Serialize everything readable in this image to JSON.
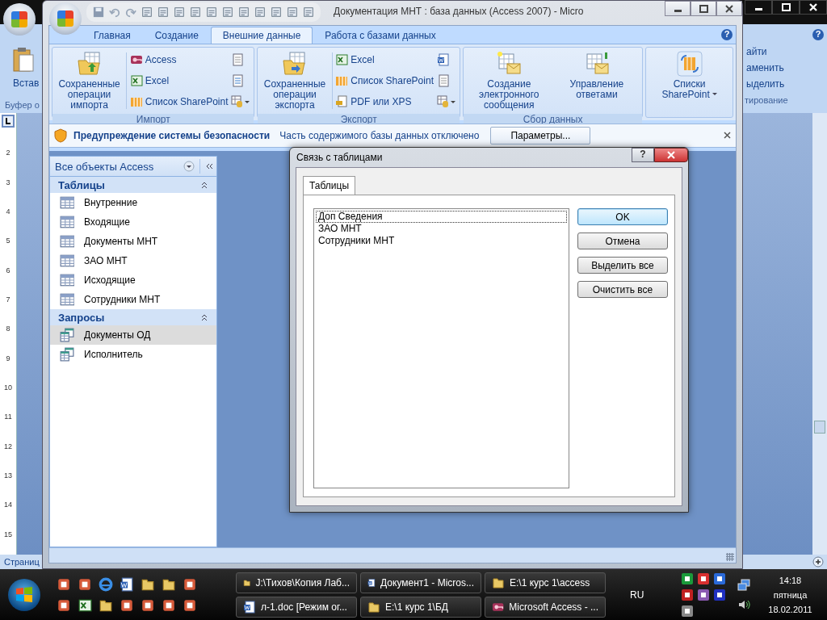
{
  "background_window": {
    "paste_button": "Встав",
    "clipboard_group": "Буфер о",
    "help_button": "?",
    "right_items": [
      "айти",
      "аменить",
      "ыделить"
    ],
    "right_group": "тирование",
    "ruler_marks": [
      "2",
      "3",
      "4",
      "5",
      "6",
      "7",
      "8",
      "9",
      "10",
      "11",
      "12",
      "13",
      "14",
      "15"
    ],
    "status": "Страниц"
  },
  "window": {
    "title": "Документация МНТ : база данных (Access 2007)  -  Micro"
  },
  "tabs": [
    {
      "label": "Главная",
      "selected": false
    },
    {
      "label": "Создание",
      "selected": false
    },
    {
      "label": "Внешние данные",
      "selected": true
    },
    {
      "label": "Работа с базами данных",
      "selected": false
    }
  ],
  "ribbon": {
    "help_button": "?",
    "groups": [
      {
        "label": "Импорт",
        "big": {
          "label": "Сохраненные операции импорта",
          "kind": "import"
        },
        "small": [
          {
            "label": "Access",
            "kind": "access"
          },
          {
            "label": "Excel",
            "kind": "excel"
          },
          {
            "label": "Список SharePoint",
            "kind": "sharepoint"
          }
        ],
        "icons": [
          {
            "kind": "text"
          },
          {
            "kind": "xml"
          },
          {
            "kind": "more"
          }
        ]
      },
      {
        "label": "Экспорт",
        "big": {
          "label": "Сохраненные операции экспорта",
          "kind": "export"
        },
        "small": [
          {
            "label": "Excel",
            "kind": "excel"
          },
          {
            "label": "Список SharePoint",
            "kind": "sharepoint"
          },
          {
            "label": "PDF или XPS",
            "kind": "pdf"
          }
        ],
        "icons": [
          {
            "kind": "word"
          },
          {
            "kind": "text"
          },
          {
            "kind": "more"
          }
        ]
      },
      {
        "label": "Сбор данных",
        "bigs": [
          {
            "label": "Создание электронного сообщения",
            "kind": "email"
          },
          {
            "label": "Управление ответами",
            "kind": "replies"
          }
        ]
      },
      {
        "bigs": [
          {
            "label": "Списки SharePoint",
            "kind": "splists"
          }
        ]
      }
    ]
  },
  "security_bar": {
    "title": "Предупреждение системы безопасности",
    "message": "Часть содержимого базы данных отключено",
    "button": "Параметры..."
  },
  "navigation": {
    "header": "Все объекты Access",
    "groups": [
      {
        "label": "Таблицы",
        "kind": "table",
        "items": [
          {
            "label": "Внутренние",
            "selected": false
          },
          {
            "label": "Входящие",
            "selected": false
          },
          {
            "label": "Документы МНТ",
            "selected": false
          },
          {
            "label": "ЗАО МНТ",
            "selected": false
          },
          {
            "label": "Исходящие",
            "selected": false
          },
          {
            "label": "Сотрудники МНТ",
            "selected": false
          }
        ]
      },
      {
        "label": "Запросы",
        "kind": "query",
        "items": [
          {
            "label": "Документы ОД",
            "selected": true
          },
          {
            "label": "Исполнитель",
            "selected": false
          }
        ]
      }
    ]
  },
  "dialog": {
    "title": "Связь с таблицами",
    "help_button": "?",
    "tab": "Таблицы",
    "items": [
      {
        "label": "Доп Сведения",
        "focused": true
      },
      {
        "label": "ЗАО МНТ",
        "focused": false
      },
      {
        "label": "Сотрудники МНТ",
        "focused": false
      }
    ],
    "buttons": [
      {
        "label": "OK",
        "default": true
      },
      {
        "label": "Отмена",
        "default": false
      },
      {
        "label": "Выделить все",
        "default": false
      },
      {
        "label": "Очистить все",
        "default": false
      }
    ]
  },
  "taskbar": {
    "tasks": [
      {
        "label": "J:\\Тихов\\Копия Лаб...",
        "kind": "folder"
      },
      {
        "label": "Документ1 - Micros...",
        "kind": "word"
      },
      {
        "label": "E:\\1 курс 1\\access",
        "kind": "folder"
      },
      {
        "label": "л-1.doc [Режим ог...",
        "kind": "word"
      },
      {
        "label": "E:\\1 курс 1\\БД",
        "kind": "folder"
      },
      {
        "label": "Microsoft Access - ...",
        "kind": "access"
      }
    ],
    "language": "RU",
    "time": "14:18",
    "weekday": "пятница",
    "date": "18.02.2011"
  }
}
